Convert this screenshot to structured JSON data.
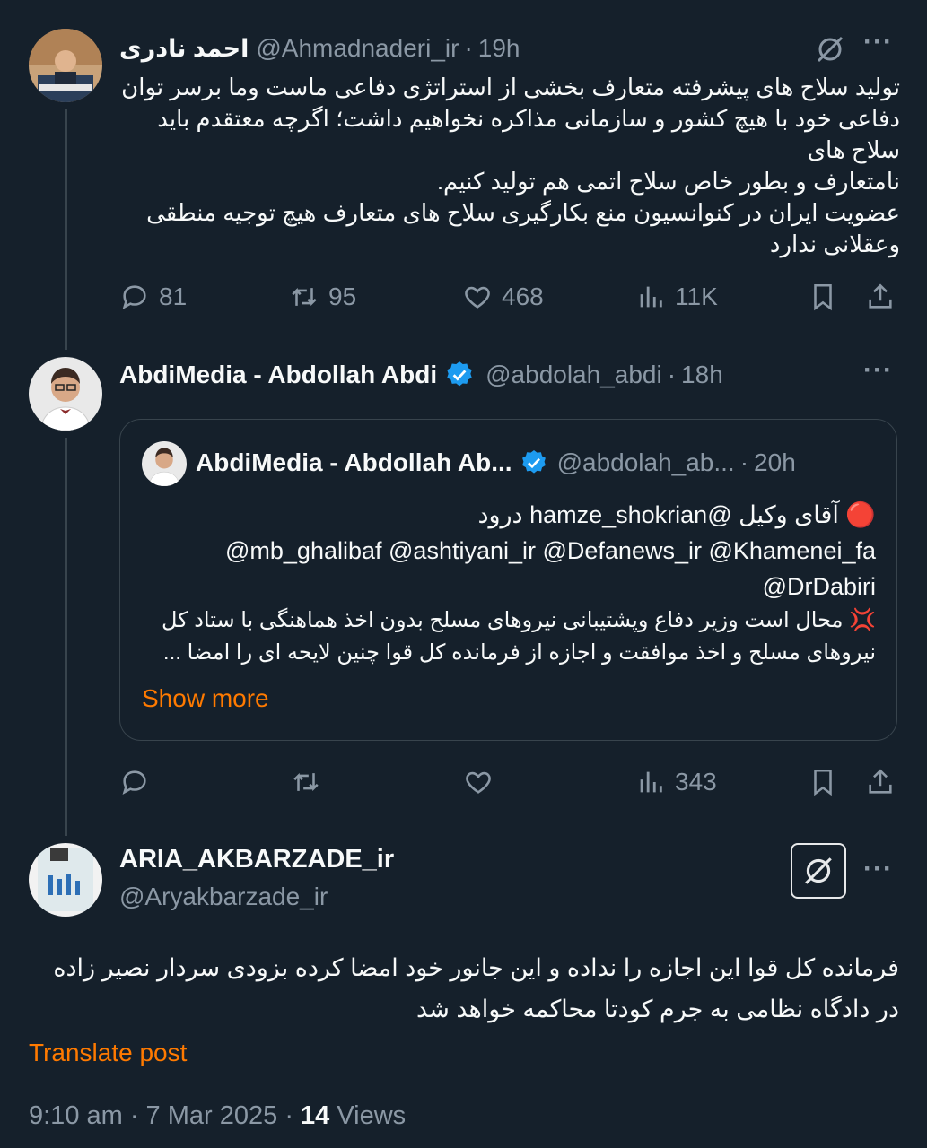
{
  "tweet1": {
    "author_name": "احمد نادری",
    "handle": "@Ahmadnaderi_ir",
    "time": "19h",
    "text_lines": [
      "تولید سلاح های پیشرفته متعارف بخشی از استراتژی دفاعی ماست وما برسر توان",
      "دفاعی خود با هیچ کشور و سازمانی مذاکره نخواهیم داشت؛ اگرچه معتقدم باید سلاح های",
      "نامتعارف و بطور خاص سلاح اتمی هم تولید کنیم.",
      "عضویت ایران در کنوانسیون منع بکارگیری سلاح های متعارف هیچ توجیه منطقی",
      "وعقلانی ندارد"
    ],
    "replies": "81",
    "reposts": "95",
    "likes": "468",
    "views": "11K"
  },
  "tweet2": {
    "author_name": "AbdiMedia - Abdollah Abdi",
    "handle": "@abdolah_abdi",
    "time": "18h",
    "views": "343",
    "quote": {
      "author_name": "AbdiMedia - Abdollah Ab...",
      "handle": "@abdolah_ab...",
      "time": "20h",
      "line1": "🔴 آقای وکیل @hamze_shokrian درود",
      "line2": "@mb_ghalibaf @ashtiyani_ir @Defanews_ir @Khamenei_fa",
      "line3": "@DrDabiri",
      "line4": "💢 محال است وزیر دفاع وپشتیبانی نیروهای مسلح بدون اخذ هماهنگی با ستاد کل",
      "line5": "نیروهای مسلح و اخذ موافقت و اجازه از فرمانده کل قوا چنین لایحه ای را امضا ...",
      "show_more": "Show more"
    }
  },
  "tweet3": {
    "author_name": "ARIA_AKBARZADE_ir",
    "handle": "@Aryakbarzade_ir",
    "text_line1": "فرمانده کل قوا این اجازه را نداده و این جانور خود امضا کرده بزودی سردار نصیر زاده",
    "text_line2": "در دادگاه نظامی به جرم کودتا محاکمه خواهد شد",
    "translate": "Translate post",
    "timestamp": "9:10 am · 7 Mar 2025 · ",
    "views_count": "14",
    "views_label": " Views"
  },
  "colors": {
    "background": "#15202b",
    "accent_link": "#ff7a00",
    "verified": "#1d9bf0",
    "muted": "#8b98a5"
  },
  "icons": [
    "grok-icon",
    "more-icon",
    "reply-icon",
    "repost-icon",
    "like-icon",
    "views-icon",
    "bookmark-icon",
    "share-icon",
    "verified-badge-icon",
    "red-circle-emoji",
    "anger-emoji"
  ]
}
